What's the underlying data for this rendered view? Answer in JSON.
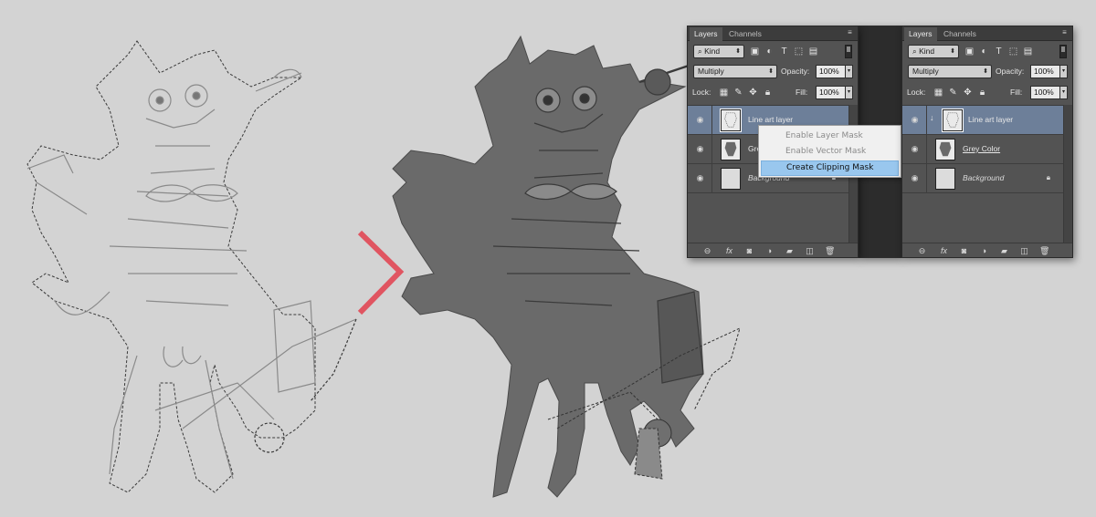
{
  "left_panel": {
    "tabs": [
      "Layers",
      "Channels"
    ],
    "filter": {
      "kind_label": "Kind"
    },
    "blend_mode": "Multiply",
    "opacity_label": "Opacity:",
    "opacity_value": "100%",
    "lock_label": "Lock:",
    "fill_label": "Fill:",
    "fill_value": "100%",
    "layers": [
      {
        "name": "Line art layer",
        "selected": true
      },
      {
        "name": "Grey",
        "selected": false
      },
      {
        "name": "Background",
        "selected": false,
        "locked": true
      }
    ]
  },
  "context_menu": {
    "items": [
      {
        "label": "Enable Layer Mask",
        "enabled": false
      },
      {
        "label": "Enable Vector Mask",
        "enabled": false
      },
      {
        "label": "Create Clipping Mask",
        "enabled": true,
        "highlighted": true
      }
    ]
  },
  "right_panel": {
    "tabs": [
      "Layers",
      "Channels"
    ],
    "filter": {
      "kind_label": "Kind"
    },
    "blend_mode": "Multiply",
    "opacity_label": "Opacity:",
    "opacity_value": "100%",
    "lock_label": "Lock:",
    "fill_label": "Fill:",
    "fill_value": "100%",
    "layers": [
      {
        "name": "Line art layer",
        "selected": true,
        "clipped": true
      },
      {
        "name": "Grey Color",
        "selected": false
      },
      {
        "name": "Background",
        "selected": false,
        "locked": true
      }
    ]
  },
  "icons": {
    "filter": [
      "search-icon",
      "image-filter-icon",
      "adjustment-filter-icon",
      "type-filter-icon",
      "shape-filter-icon",
      "smart-object-filter-icon"
    ],
    "lock": [
      "lock-transparent-icon",
      "lock-image-icon",
      "lock-position-icon",
      "lock-all-icon"
    ],
    "footer": [
      "link-layers-icon",
      "fx-icon",
      "add-mask-icon",
      "adjustment-layer-icon",
      "new-group-icon",
      "new-layer-icon",
      "trash-icon"
    ]
  },
  "colors": {
    "panel_bg": "#535353",
    "selected_layer": "#6d7f99",
    "menu_highlight": "#99c7ee",
    "chevron_red": "#e05561",
    "canvas_bg": "#d3d3d3"
  }
}
